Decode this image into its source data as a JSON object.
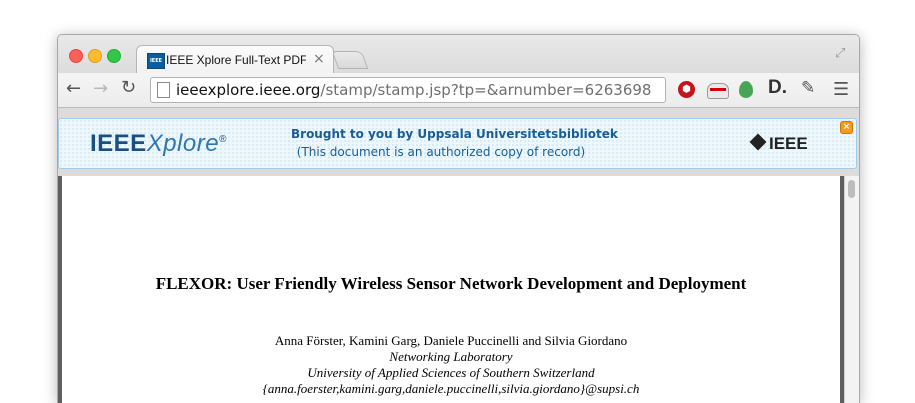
{
  "browser": {
    "tab_title": "IEEE Xplore Full-Text PDF:",
    "tab_favicon_text": "IEEE",
    "tab_close": "×",
    "url_host": "ieeexplore.ieee.org",
    "url_path": "/stamp/stamp.jsp?tp=&arnumber=6263698",
    "icons": {
      "back": "back-arrow-icon",
      "forward": "forward-arrow-icon",
      "reload": "reload-icon",
      "star": "bookmark-star-icon",
      "extensions": [
        "ublock-icon",
        "ghostery-icon",
        "evernote-icon",
        "d-extension-icon",
        "wrench-icon"
      ],
      "menu": "hamburger-menu-icon"
    },
    "ext_d_label": "D."
  },
  "banner": {
    "logo_main": "IEEE",
    "logo_italic": "Xplore",
    "logo_reg": "®",
    "brought_by": "Brought to you by Uppsala Universitetsbibliotek",
    "authorized": "(This document is an authorized copy of record)",
    "ieee_mark": "IEEE",
    "close": "×",
    "accent_color": "#1b5d92"
  },
  "paper": {
    "title": "FLEXOR: User Friendly Wireless Sensor Network Development and Deployment",
    "authors": "Anna Förster, Kamini Garg, Daniele Puccinelli and Silvia Giordano",
    "lab": "Networking Laboratory",
    "university": "University of Applied Sciences of Southern Switzerland",
    "emails": "{anna.foerster,kamini.garg,daniele.puccinelli,silvia.giordano}@supsi.ch"
  }
}
